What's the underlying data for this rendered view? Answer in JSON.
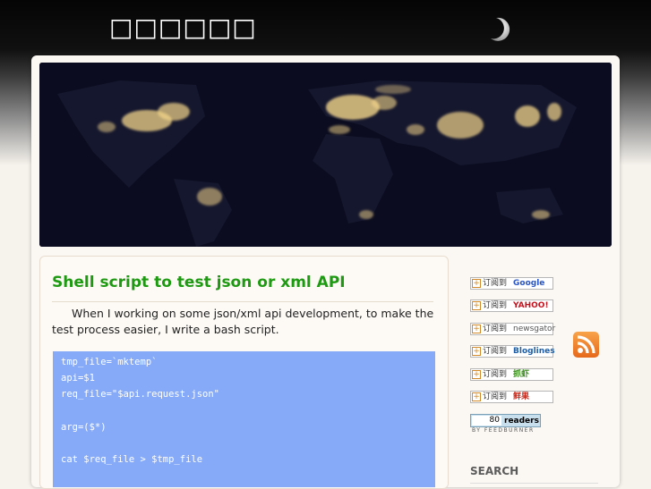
{
  "header": {
    "site_title": "□□□□□□",
    "moon_icon": "crescent-moon-icon"
  },
  "banner": {
    "image": "world-night-lights-map"
  },
  "post": {
    "title": "Shell script to test json or xml API",
    "intro": "When I working on some json/xml api development, to make the test process easier, I write a bash script.",
    "code_lines": [
      "tmp_file=`mktemp`",
      "api=$1",
      "req_file=\"$api.request.json\"",
      "",
      "arg=($*)",
      "",
      "cat $req_file > $tmp_file"
    ]
  },
  "sidebar": {
    "subscribe_prefix": "订阅到",
    "subscribe_buttons": [
      {
        "brand": "Google",
        "color": "#2a56c6"
      },
      {
        "brand": "YAHOO!",
        "color": "#c4131e"
      },
      {
        "brand": "newsgator",
        "color": "#555555"
      },
      {
        "brand": "Bloglines",
        "color": "#1e5fa8"
      },
      {
        "brand": "抓虾",
        "color": "#3a8a1e"
      },
      {
        "brand": "鲜果",
        "color": "#c3281a"
      }
    ],
    "rss_icon": "rss-feed-icon",
    "feedburner": {
      "count": "80",
      "label": "readers",
      "by": "BY FEEDBURNER"
    },
    "search_heading": "SEARCH"
  },
  "colors": {
    "title_green": "#1e9a12",
    "code_bg": "#86aaf8",
    "rss_orange": "#e6691a"
  }
}
